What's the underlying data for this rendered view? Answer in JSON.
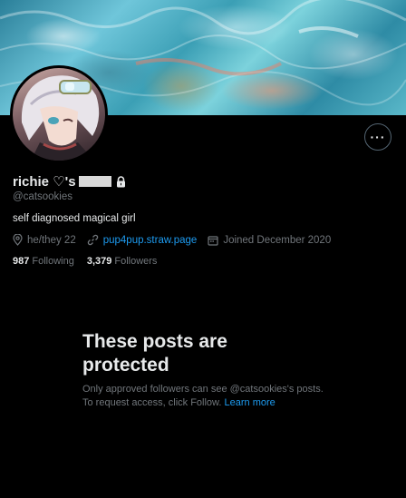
{
  "profile": {
    "display_name": "richie ♡'s",
    "handle": "@catsookies",
    "bio": "self diagnosed magical girl",
    "pronouns": "he/they 22",
    "website": "pup4pup.straw.page",
    "joined": "Joined December 2020",
    "following_count": "987",
    "following_label": "Following",
    "followers_count": "3,379",
    "followers_label": "Followers"
  },
  "protected": {
    "title": "These posts are protected",
    "body": "Only approved followers can see @catsookies's posts. To request access, click Follow.",
    "learn_more": "Learn more"
  },
  "icons": {
    "more": "more-icon",
    "lock": "lock-icon",
    "location": "location-icon",
    "link": "link-icon",
    "calendar": "calendar-icon"
  },
  "colors": {
    "background": "#000000",
    "text": "#e7e9ea",
    "secondary": "#71767b",
    "accent": "#1d9bf0"
  }
}
